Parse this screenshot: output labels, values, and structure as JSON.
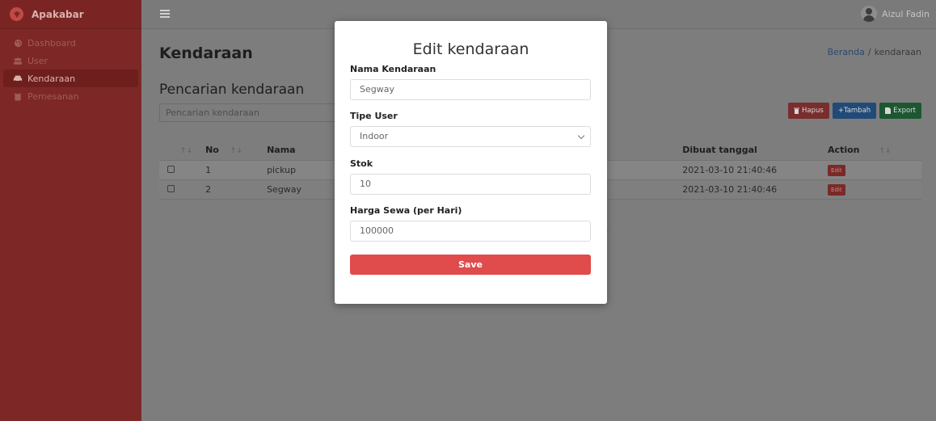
{
  "sidebar": {
    "brand": "Apakabar",
    "items": [
      {
        "label": "Dashboard",
        "icon": "palette-icon",
        "active": false
      },
      {
        "label": "User",
        "icon": "users-icon",
        "active": false
      },
      {
        "label": "Kendaraan",
        "icon": "car-icon",
        "active": true
      },
      {
        "label": "Pemesanan",
        "icon": "clipboard-icon",
        "active": false
      }
    ]
  },
  "topbar": {
    "user_name": "Aizul Fadin"
  },
  "page": {
    "title": "Kendaraan",
    "breadcrumb": {
      "home": "Beranda",
      "separator": "/",
      "current": "kendaraan"
    },
    "section_title": "Pencarian kendaraan",
    "search_placeholder": "Pencarian kendaraan",
    "buttons": {
      "hapus": "Hapus",
      "tambah": "+Tambah",
      "export": "Export"
    }
  },
  "table": {
    "columns": [
      "No",
      "Nama",
      "Dibuat tanggal",
      "Action"
    ],
    "rows": [
      {
        "no": "1",
        "nama": "pickup",
        "dibuat": "2021-03-10 21:40:46",
        "action": "Edit"
      },
      {
        "no": "2",
        "nama": "Segway",
        "dibuat": "2021-03-10 21:40:46",
        "action": "Edit"
      }
    ]
  },
  "modal": {
    "title": "Edit kendaraan",
    "fields": {
      "nama_label": "Nama Kendaraan",
      "nama_value": "Segway",
      "tipe_label": "Tipe User",
      "tipe_value": "Indoor",
      "stok_label": "Stok",
      "stok_value": "10",
      "harga_label": "Harga Sewa (per Hari)",
      "harga_value": "100000"
    },
    "save_label": "Save"
  },
  "colors": {
    "sidebar_bg": "#7d2826",
    "save_button": "#e04b4b",
    "tambah_button": "#214a78",
    "export_button": "#1c5732",
    "hapus_button": "#792d2d"
  }
}
